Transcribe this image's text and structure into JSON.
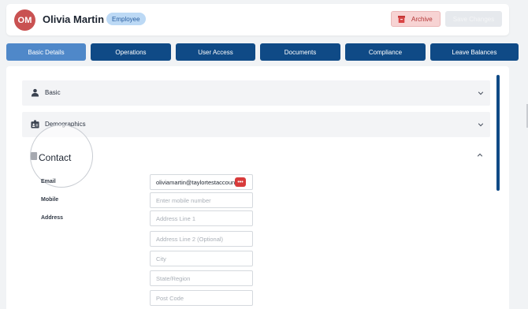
{
  "header": {
    "avatar_initials": "OM",
    "employee_name": "Olivia Martin",
    "role_badge": "Employee",
    "archive_label": "Archive",
    "save_label": "Save Changes"
  },
  "tabs": [
    {
      "label": "Basic Details",
      "active": true
    },
    {
      "label": "Operations",
      "active": false
    },
    {
      "label": "User Access",
      "active": false
    },
    {
      "label": "Documents",
      "active": false
    },
    {
      "label": "Compliance",
      "active": false
    },
    {
      "label": "Leave Balances",
      "active": false
    }
  ],
  "sections": {
    "basic": {
      "label": "Basic",
      "icon": "person-icon",
      "expanded": false
    },
    "demographics": {
      "label": "Demographics",
      "icon": "id-card-icon",
      "expanded": false
    },
    "contact": {
      "label": "Contact",
      "icon": "contact-card-icon",
      "expanded": true
    }
  },
  "contact": {
    "email_label": "Email",
    "email_value": "oliviamartin@taylortestaccount.c",
    "mobile_label": "Mobile",
    "mobile_placeholder": "Enter mobile number",
    "address_label": "Address",
    "address_line1_placeholder": "Address Line 1",
    "address_line2_placeholder": "Address Line 2 (Optional)",
    "city_placeholder": "City",
    "state_placeholder": "State/Region",
    "postcode_placeholder": "Post Code"
  },
  "password_manager_badge": "•••",
  "colors": {
    "primary_tab": "#0f4a86",
    "active_tab": "#4f88c9",
    "avatar": "#c95252",
    "archive_bg": "#f7d3d3",
    "archive_text": "#b23333",
    "badge_bg": "#bcd9f5"
  }
}
